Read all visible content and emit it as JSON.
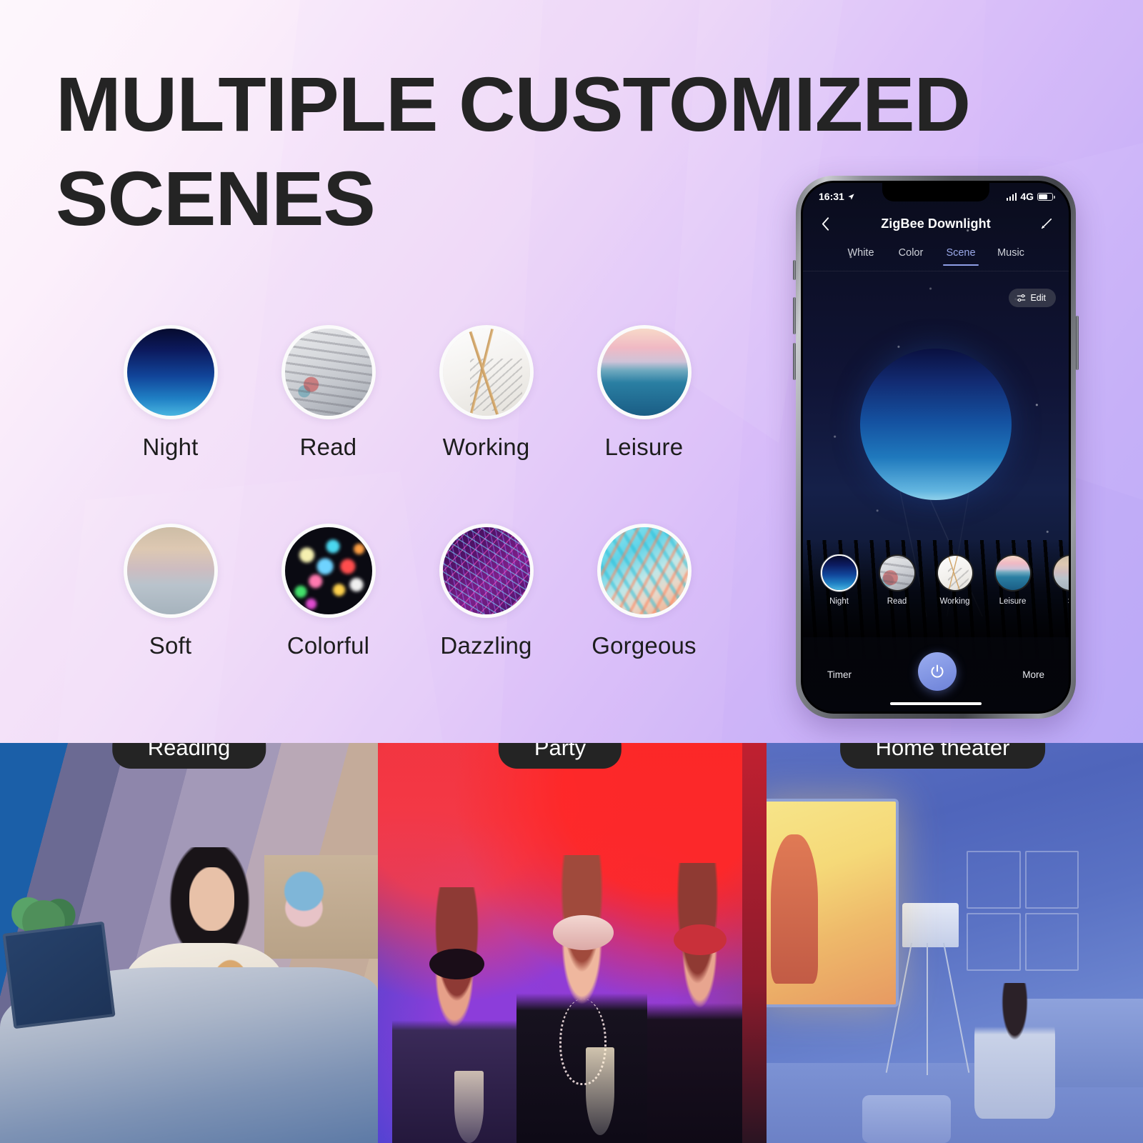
{
  "hero": {
    "title_line1": "MULTIPLE CUSTOMIZED",
    "title_line2": "SCENES"
  },
  "scenes": [
    {
      "label": "Night",
      "thumb": "th-night"
    },
    {
      "label": "Read",
      "thumb": "th-read"
    },
    {
      "label": "Working",
      "thumb": "th-working"
    },
    {
      "label": "Leisure",
      "thumb": "th-leisure"
    },
    {
      "label": "Soft",
      "thumb": "th-soft"
    },
    {
      "label": "Colorful",
      "thumb": "th-colorful"
    },
    {
      "label": "Dazzling",
      "thumb": "th-dazzling"
    },
    {
      "label": "Gorgeous",
      "thumb": "th-gorgeous"
    }
  ],
  "phone": {
    "status": {
      "time": "16:31",
      "location_icon": "location-arrow-icon",
      "signal_icon": "signal-bars-icon",
      "network": "4G",
      "battery_icon": "battery-icon"
    },
    "nav": {
      "back_icon": "chevron-left-icon",
      "title": "ZigBee Downlight",
      "edit_icon": "pencil-icon"
    },
    "tabs": [
      {
        "label": "White",
        "active": false
      },
      {
        "label": "Color",
        "active": false
      },
      {
        "label": "Scene",
        "active": true
      },
      {
        "label": "Music",
        "active": false
      }
    ],
    "edit_chip": {
      "label": "Edit",
      "icon": "sliders-icon"
    },
    "carousel": [
      {
        "label": "Night",
        "thumb": "th-night",
        "selected": true
      },
      {
        "label": "Read",
        "thumb": "th-read",
        "selected": false
      },
      {
        "label": "Working",
        "thumb": "th-working",
        "selected": false
      },
      {
        "label": "Leisure",
        "thumb": "th-leisure",
        "selected": false
      },
      {
        "label": "S",
        "thumb": "th-soft",
        "selected": false
      }
    ],
    "bottom": {
      "timer_label": "Timer",
      "more_label": "More",
      "power_icon": "power-icon"
    }
  },
  "photos": [
    {
      "pill": "Reading"
    },
    {
      "pill": "Party"
    },
    {
      "pill": "Home theater"
    }
  ],
  "colors": {
    "title_text": "#242424",
    "pill_bg": "#242424",
    "pill_text": "#ffffff",
    "tab_active": "#9aa8e8",
    "power_button": "#8b9ee0",
    "gradient_start": "#fdf6fb",
    "gradient_end": "#b8a6f6"
  }
}
